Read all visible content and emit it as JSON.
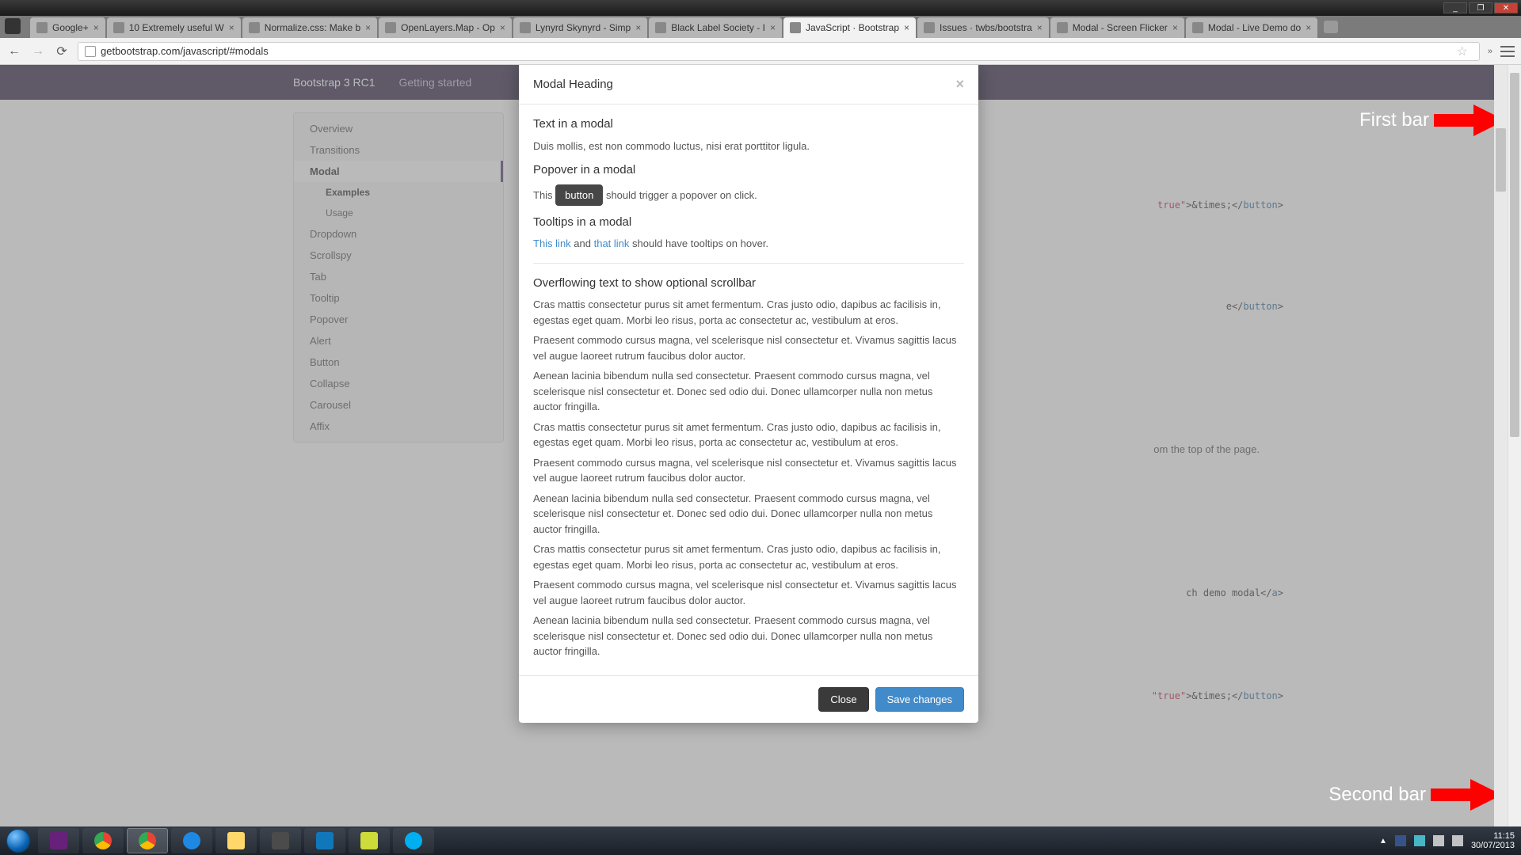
{
  "window": {
    "min": "_",
    "max": "❐",
    "close": "✕"
  },
  "tabs": [
    {
      "label": "Google+",
      "fav": "fav-gp"
    },
    {
      "label": "10 Extremely useful W",
      "fav": "fav-hn"
    },
    {
      "label": "Normalize.css: Make b",
      "fav": "fav-ncss"
    },
    {
      "label": "OpenLayers.Map - Op",
      "fav": "fav-ol"
    },
    {
      "label": "Lynyrd Skynyrd - Simp",
      "fav": "fav-yt"
    },
    {
      "label": "Black Label Society - I",
      "fav": "fav-yt"
    },
    {
      "label": "JavaScript · Bootstrap",
      "fav": "fav-bs",
      "active": true
    },
    {
      "label": "Issues · twbs/bootstra",
      "fav": "fav-gh"
    },
    {
      "label": "Modal - Screen Flicker",
      "fav": "fav-gh"
    },
    {
      "label": "Modal - Live Demo do",
      "fav": "fav-gh"
    }
  ],
  "url": "getbootstrap.com/javascript/#modals",
  "bsnav": {
    "brand": "Bootstrap 3 RC1",
    "link1": "Getting started"
  },
  "sidenav": [
    "Overview",
    "Transitions",
    "Modal",
    "Examples",
    "Usage",
    "Dropdown",
    "Scrollspy",
    "Tab",
    "Tooltip",
    "Popover",
    "Alert",
    "Button",
    "Collapse",
    "Carousel",
    "Affix"
  ],
  "modal": {
    "title": "Modal Heading",
    "h1": "Text in a modal",
    "p1": "Duis mollis, est non commodo luctus, nisi erat porttitor ligula.",
    "h2": "Popover in a modal",
    "p2a": "This ",
    "btn": "button",
    "p2b": " should trigger a popover on click.",
    "h3": "Tooltips in a modal",
    "link1": "This link",
    "and": " and ",
    "link2": "that link",
    "p3b": " should have tooltips on hover.",
    "h4": "Overflowing text to show optional scrollbar",
    "para_a": "Cras mattis consectetur purus sit amet fermentum. Cras justo odio, dapibus ac facilisis in, egestas eget quam. Morbi leo risus, porta ac consectetur ac, vestibulum at eros.",
    "para_b": "Praesent commodo cursus magna, vel scelerisque nisl consectetur et. Vivamus sagittis lacus vel augue laoreet rutrum faucibus dolor auctor.",
    "para_c": "Aenean lacinia bibendum nulla sed consectetur. Praesent commodo cursus magna, vel scelerisque nisl consectetur et. Donec sed odio dui. Donec ullamcorper nulla non metus auctor fringilla.",
    "close": "Close",
    "save": "Save changes"
  },
  "bgtext": {
    "peek": "om the top of the page."
  },
  "code": {
    "l1a": "true\"",
    "l1b": ">&times;</",
    "l1c": "button",
    "l1d": ">",
    "l2a": "e</",
    "l2b": "button",
    "l2c": ">",
    "l3a": "ch demo modal</",
    "l3b": "a",
    "l3c": ">",
    "l4a": "\"true\"",
    "l4b": ">&times;</",
    "l4c": "button",
    "l4d": ">"
  },
  "annot": {
    "first": "First bar",
    "second": "Second bar"
  },
  "tray": {
    "time": "11:15",
    "date": "30/07/2013"
  }
}
